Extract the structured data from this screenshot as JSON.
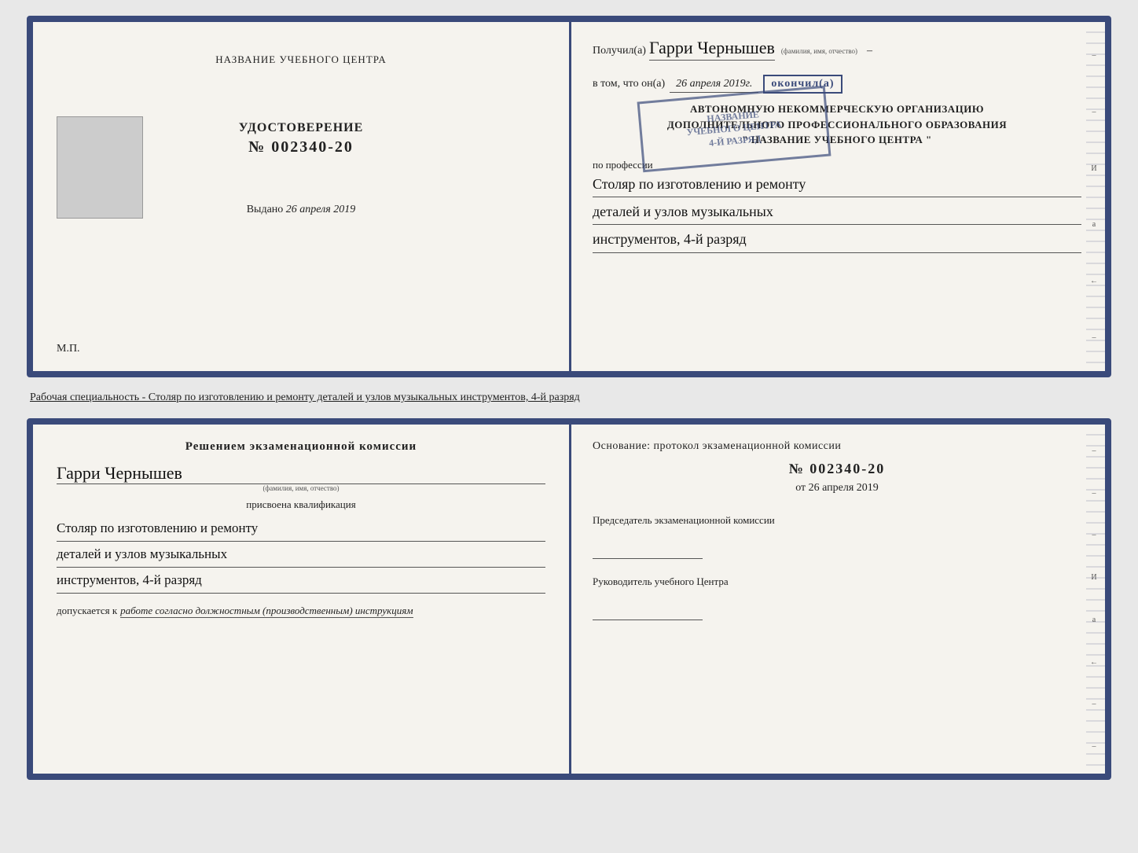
{
  "top_doc": {
    "left": {
      "center_title": "НАЗВАНИЕ УЧЕБНОГО ЦЕНТРА",
      "udostoverenie_title": "УДОСТОВЕРЕНИЕ",
      "udostoverenie_num": "№ 002340-20",
      "vydano_label": "Выдано",
      "vydano_date": "26 апреля 2019",
      "mp_label": "М.П."
    },
    "right": {
      "poluchil_label": "Получил(а)",
      "recipient_name": "Гарри Чернышев",
      "fio_hint": "(фамилия, имя, отчество)",
      "vtom_label": "в том, что он(а)",
      "vtom_date": "26 апреля 2019г.",
      "okoncil_label": "окончил(а)",
      "org_line1": "АВТОНОМНУЮ НЕКОММЕРЧЕСКУЮ ОРГАНИЗАЦИЮ",
      "org_line2": "ДОПОЛНИТЕЛЬНОГО ПРОФЕССИОНАЛЬНОГО ОБРАЗОВАНИЯ",
      "org_line3": "\" НАЗВАНИЕ УЧЕБНОГО ЦЕНТРА \"",
      "po_professii_label": "по профессии",
      "profession_line1": "Столяр по изготовлению и ремонту",
      "profession_line2": "деталей и узлов музыкальных",
      "profession_line3": "инструментов, 4-й разряд"
    }
  },
  "specialty_text": "Рабочая специальность - Столяр по изготовлению и ремонту деталей и узлов музыкальных инструментов, 4-й разряд",
  "bottom_doc": {
    "left": {
      "resheniem_text": "Решением  экзаменационной  комиссии",
      "name": "Гарри Чернышев",
      "fio_hint": "(фамилия, имя, отчество)",
      "prisvoena_label": "присвоена квалификация",
      "qual_line1": "Столяр по изготовлению и ремонту",
      "qual_line2": "деталей и узлов музыкальных",
      "qual_line3": "инструментов, 4-й разряд",
      "dopuskaetsya_label": "допускается к",
      "dopusk_text": "работе согласно должностным (производственным) инструкциям"
    },
    "right": {
      "osnovanie_label": "Основание: протокол экзаменационной  комиссии",
      "protocol_num": "№  002340-20",
      "ot_label": "от",
      "ot_date": "26 апреля 2019",
      "predsedatel_label": "Председатель экзаменационной комиссии",
      "rukovoditel_label": "Руководитель учебного Центра"
    }
  },
  "side_labels": [
    "–",
    "–",
    "–",
    "И",
    "а",
    "←",
    "–",
    "–",
    "–",
    "–"
  ]
}
